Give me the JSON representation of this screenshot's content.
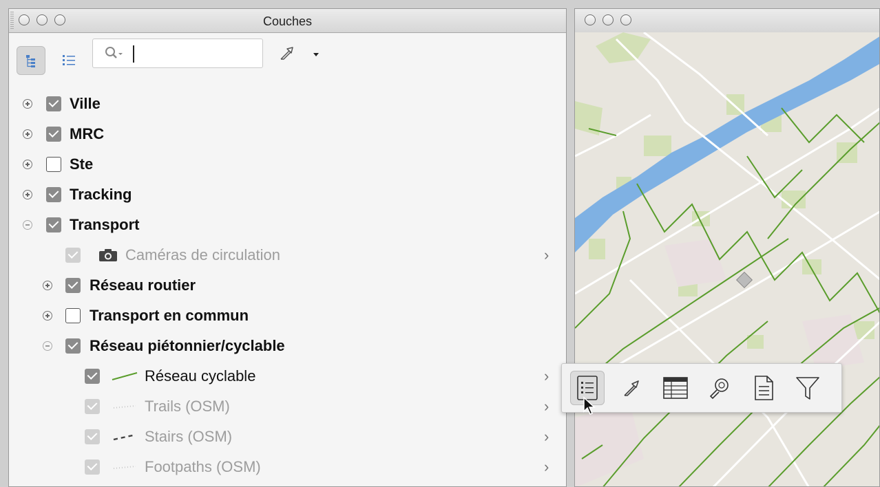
{
  "layers_window": {
    "title": "Couches",
    "search": {
      "value": "",
      "placeholder": ""
    }
  },
  "tree": [
    {
      "label": "Ville",
      "checked": true,
      "expander": "plus",
      "style": "bold"
    },
    {
      "label": "MRC",
      "checked": true,
      "expander": "plus",
      "style": "bold"
    },
    {
      "label": "Ste",
      "checked": false,
      "expander": "plus",
      "style": "bold"
    },
    {
      "label": "Tracking",
      "checked": true,
      "expander": "plus",
      "style": "bold"
    },
    {
      "label": "Transport",
      "checked": true,
      "expander": "minus",
      "style": "bold"
    },
    {
      "label": "Caméras de circulation",
      "checked": true,
      "style": "dim",
      "icon": "camera-icon"
    },
    {
      "label": "Réseau routier",
      "checked": true,
      "expander": "plus",
      "style": "bold"
    },
    {
      "label": "Transport en commun",
      "checked": false,
      "expander": "plus",
      "style": "bold"
    },
    {
      "label": "Réseau piétonnier/cyclable",
      "checked": true,
      "expander": "minus",
      "style": "bold"
    },
    {
      "label": "Réseau cyclable",
      "checked": true,
      "style": "normal",
      "icon": "green-line-legend-icon"
    },
    {
      "label": "Trails (OSM)",
      "checked": true,
      "style": "dim",
      "icon": "dotted-line-legend-icon"
    },
    {
      "label": "Stairs (OSM)",
      "checked": true,
      "style": "dim",
      "icon": "dashed-line-legend-icon"
    },
    {
      "label": "Footpaths (OSM)",
      "checked": true,
      "style": "dim",
      "icon": "dotted-line-legend-icon"
    }
  ],
  "popup_actions": [
    {
      "name": "properties-icon",
      "selected": true
    },
    {
      "name": "zoom-to-layer-icon"
    },
    {
      "name": "attribute-table-icon"
    },
    {
      "name": "search-layer-icon"
    },
    {
      "name": "metadata-icon"
    },
    {
      "name": "filter-icon"
    }
  ],
  "colors": {
    "water": "#7fb1e3",
    "bike_network": "#5a9d2c",
    "park": "#d7e3bd",
    "panel_bg": "#f5f5f5"
  }
}
